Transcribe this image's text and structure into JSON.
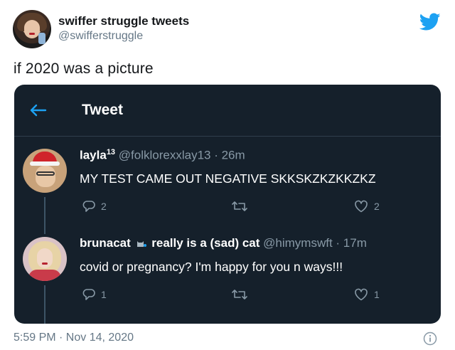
{
  "outer_tweet": {
    "author_name": "swiffer struggle tweets",
    "author_handle": "@swifferstruggle",
    "text": "if 2020 was a picture",
    "timestamp": "5:59 PM · Nov 14, 2020"
  },
  "screenshot": {
    "header_title": "Tweet",
    "tweets": [
      {
        "name": "layla",
        "name_sup": "13",
        "handle": "@folklorexxlay13",
        "time": " · 26m",
        "text": "MY TEST CAME OUT NEGATIVE SKKSKZKZKKZKZ",
        "reply_count": "2",
        "like_count": "2"
      },
      {
        "name": "brunacat",
        "name_suffix": "really is a (sad) cat",
        "handle": "@himymswft",
        "time": " · 17m",
        "text": "covid or pregnancy? I'm happy for you n ways!!!",
        "reply_count": "1",
        "like_count": "1"
      }
    ]
  },
  "colors": {
    "twitter_blue": "#1da1f2",
    "card_bg": "#15202b",
    "muted": "#8899a6"
  },
  "icons": [
    "twitter-bird-icon",
    "back-arrow-icon",
    "reply-icon",
    "retweet-icon",
    "like-icon",
    "info-icon",
    "cat-icon"
  ]
}
